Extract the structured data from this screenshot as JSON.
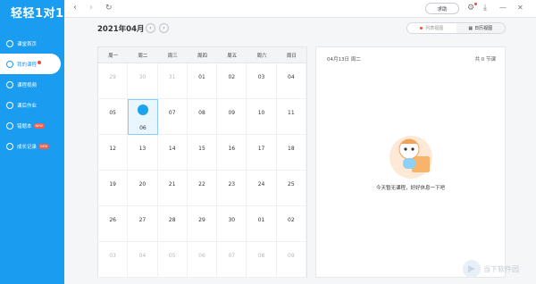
{
  "app": {
    "logo": "轻轻1对1"
  },
  "nav": [
    {
      "label": "课堂首页",
      "icon": "home-icon"
    },
    {
      "label": "我的课程",
      "icon": "book-icon",
      "dot": true,
      "active": true
    },
    {
      "label": "课程视频",
      "icon": "play-icon"
    },
    {
      "label": "课后作业",
      "icon": "homework-icon"
    },
    {
      "label": "错题本",
      "icon": "notebook-icon",
      "badge": "NEW"
    },
    {
      "label": "成长记录",
      "icon": "growth-icon",
      "badge": "NEW"
    }
  ],
  "topbar": {
    "back": "‹",
    "forward": "›",
    "refresh": "↻",
    "help": "求助",
    "settings": "⚙",
    "download": "⤓",
    "minimize": "—",
    "close": "✕"
  },
  "calendar": {
    "month_label": "2021年04月",
    "prev": "‹",
    "next": "›",
    "weekdays": [
      "周一",
      "周二",
      "周三",
      "周四",
      "周五",
      "周六",
      "周日"
    ],
    "days": [
      "29",
      "30",
      "31",
      "01",
      "02",
      "03",
      "04",
      "05",
      "06",
      "07",
      "08",
      "09",
      "10",
      "11",
      "12",
      "13",
      "14",
      "15",
      "16",
      "17",
      "18",
      "19",
      "20",
      "21",
      "22",
      "23",
      "24",
      "25",
      "26",
      "27",
      "28",
      "29",
      "30",
      "01",
      "02",
      "03",
      "04",
      "05",
      "06",
      "07",
      "08",
      "09"
    ],
    "other_month": [
      0,
      1,
      2,
      35,
      36,
      37,
      38,
      39,
      40,
      41
    ],
    "today_index": 8
  },
  "view_toggle": {
    "list": "列表视图",
    "calendar": "日历视图"
  },
  "panel": {
    "date": "04月13日  周二",
    "count": "共 0 节课",
    "empty_text": "今天暂无课程，好好休息一下吧"
  },
  "watermark": {
    "text": "当下软件园"
  },
  "colors": {
    "sidebar": "#1a9cf0",
    "accent": "#1aa3ef",
    "today_bg": "#eaf6ff"
  }
}
